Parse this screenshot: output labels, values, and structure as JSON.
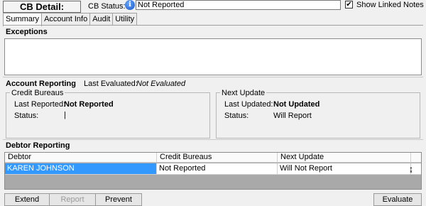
{
  "header": {
    "title": "CB Detail:",
    "status_label": "CB Status:",
    "status_value": "Not Reported",
    "info_icon": "i",
    "show_linked_notes_label": "Show Linked Notes",
    "show_linked_notes_checked": true
  },
  "tabs": [
    {
      "label": "Summary",
      "active": true
    },
    {
      "label": "Account Info",
      "active": false
    },
    {
      "label": "Audit",
      "active": false
    },
    {
      "label": "Utility",
      "active": false
    }
  ],
  "exceptions": {
    "label": "Exceptions"
  },
  "account_reporting": {
    "label": "Account Reporting",
    "last_evaluated_label": "Last Evaluated:",
    "last_evaluated_value": "Not Evaluated",
    "credit_bureaus": {
      "title": "Credit Bureaus",
      "last_reported_label": "Last Reported:",
      "last_reported_value": "Not Reported",
      "status_label": "Status:",
      "status_value": "|"
    },
    "next_update": {
      "title": "Next Update",
      "last_updated_label": "Last Updated:",
      "last_updated_value": "Not Updated",
      "status_label": "Status:",
      "status_value": "Will Report"
    }
  },
  "debtor_reporting": {
    "label": "Debtor Reporting",
    "columns": [
      "Debtor",
      "Credit Bureaus",
      "Next Update"
    ],
    "rows": [
      {
        "debtor": "KAREN JOHNSON",
        "credit_bureaus": "Not Reported",
        "next_update": "Will Not Report"
      }
    ],
    "cursor_glyph": "↨"
  },
  "buttons": {
    "extend": "Extend",
    "report": "Report",
    "prevent": "Prevent",
    "evaluate": "Evaluate"
  },
  "colors": {
    "selection": "#3399ff",
    "info_icon": "#1657c7"
  }
}
